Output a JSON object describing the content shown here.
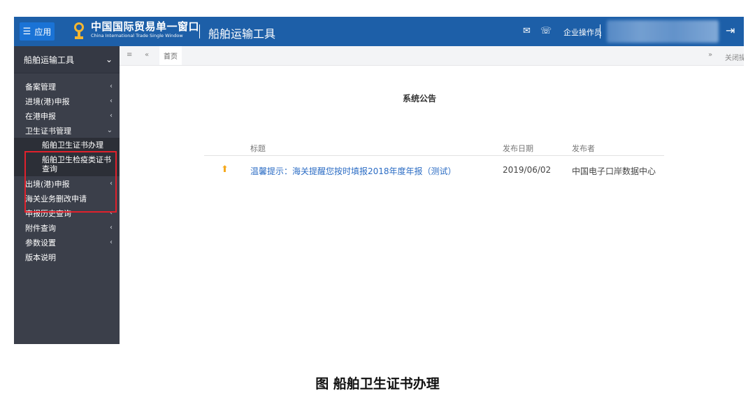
{
  "topbar": {
    "menu_label": "应用",
    "brand_cn": "中国国际贸易单一窗口",
    "brand_en": "China International Trade Single Window",
    "app_title": "船舶运输工具",
    "user_role": "企业操作员",
    "icons": [
      "mail-icon",
      "headset-icon",
      "logout-icon"
    ],
    "accent_color": "#1d5fa8"
  },
  "sidebar": {
    "header": "船舶运输工具",
    "items": [
      {
        "label": "备案管理",
        "has_children": true
      },
      {
        "label": "进境(港)申报",
        "has_children": true
      },
      {
        "label": "在港申报",
        "has_children": true
      },
      {
        "label": "卫生证书管理",
        "has_children": true,
        "expanded": true
      },
      {
        "label": "出境(港)申报",
        "has_children": true
      },
      {
        "label": "海关业务删改申请",
        "has_children": false
      },
      {
        "label": "申报历史查询",
        "has_children": true
      },
      {
        "label": "附件查询",
        "has_children": true
      },
      {
        "label": "参数设置",
        "has_children": true
      },
      {
        "label": "版本说明",
        "has_children": false
      }
    ],
    "subitems": [
      "船舶卫生证书办理",
      "船舶卫生检疫类证书查询"
    ]
  },
  "tabs": {
    "home": "首页",
    "close_ops": "关闭操作"
  },
  "notice": {
    "title": "系统公告",
    "columns": [
      "标题",
      "发布日期",
      "发布者"
    ],
    "rows": [
      {
        "title": "温馨提示：海关提醒您按时填报2018年度年报（测试）",
        "date": "2019/06/02",
        "publisher": "中国电子口岸数据中心"
      }
    ]
  },
  "caption": "图 船舶卫生证书办理"
}
